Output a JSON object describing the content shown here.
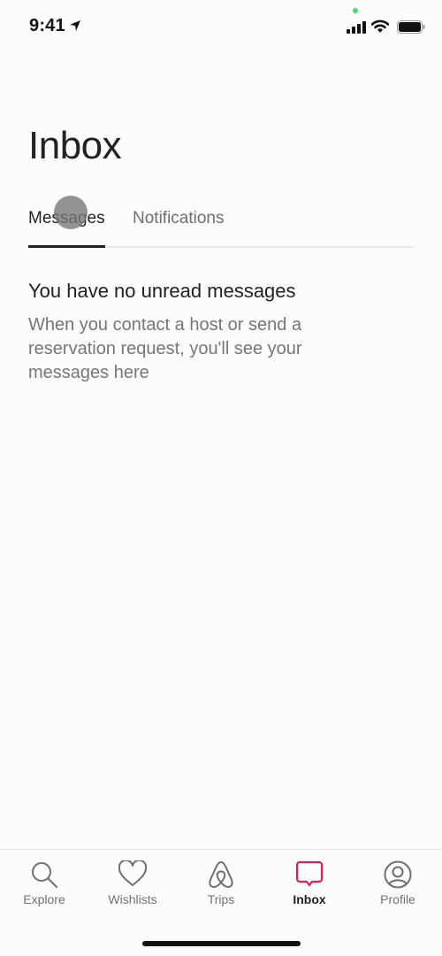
{
  "status_bar": {
    "time": "9:41",
    "icons": [
      "location-arrow-icon",
      "signal-icon",
      "wifi-icon",
      "battery-icon"
    ]
  },
  "header": {
    "title": "Inbox"
  },
  "tabs": [
    {
      "label": "Messages",
      "active": true
    },
    {
      "label": "Notifications",
      "active": false
    }
  ],
  "empty_state": {
    "title": "You have no unread messages",
    "body": "When you contact a host or send a reservation request, you'll see your messages here"
  },
  "bottom_nav": {
    "accent_color": "#e01e5a",
    "items": [
      {
        "label": "Explore",
        "icon": "search-icon",
        "active": false
      },
      {
        "label": "Wishlists",
        "icon": "heart-icon",
        "active": false
      },
      {
        "label": "Trips",
        "icon": "airbnb-logo-icon",
        "active": false
      },
      {
        "label": "Inbox",
        "icon": "message-bubble-icon",
        "active": true
      },
      {
        "label": "Profile",
        "icon": "user-circle-icon",
        "active": false
      }
    ]
  }
}
